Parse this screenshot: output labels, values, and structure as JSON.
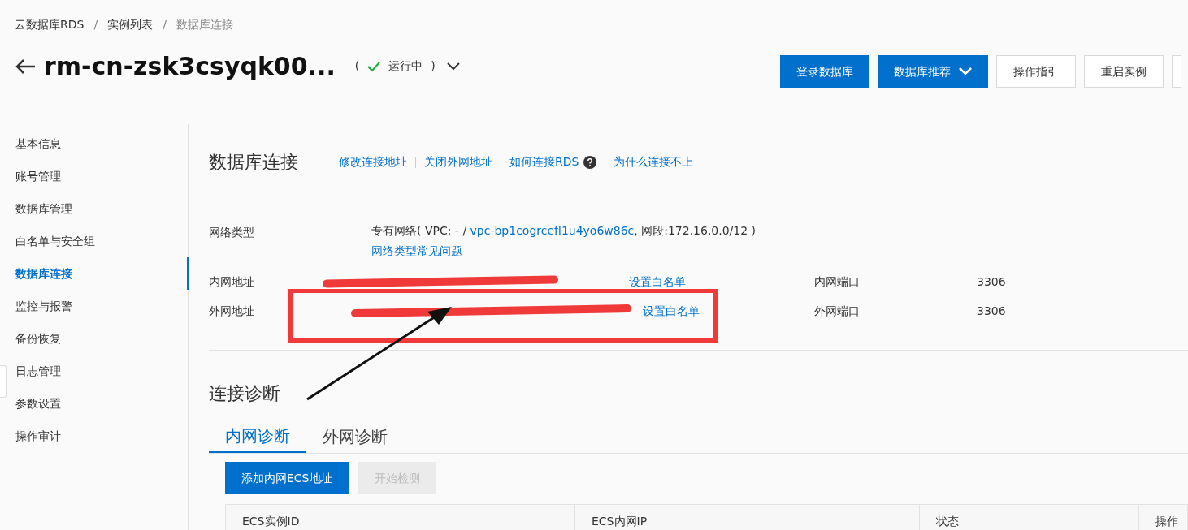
{
  "breadcrumb": [
    "云数据库RDS",
    "实例列表",
    "数据库连接"
  ],
  "breadcrumb_separator": "/",
  "instance": {
    "title": "rm-cn-zsk3csyqk00...",
    "open": "(",
    "status": "运行中",
    "close": ")",
    "running": true
  },
  "header_buttons": [
    {
      "label": "登录数据库",
      "primary": true,
      "dropdown": false
    },
    {
      "label": "数据库推荐",
      "primary": true,
      "dropdown": true
    },
    {
      "label": "操作指引",
      "primary": false,
      "dropdown": false
    },
    {
      "label": "重启实例",
      "primary": false,
      "dropdown": false
    }
  ],
  "sidebar": {
    "items": [
      {
        "label": "基本信息",
        "selected": false
      },
      {
        "label": "账号管理",
        "selected": false
      },
      {
        "label": "数据库管理",
        "selected": false
      },
      {
        "label": "白名单与安全组",
        "selected": false
      },
      {
        "label": "数据库连接",
        "selected": true
      },
      {
        "label": "监控与报警",
        "selected": false
      },
      {
        "label": "备份恢复",
        "selected": false
      },
      {
        "label": "日志管理",
        "selected": false
      },
      {
        "label": "参数设置",
        "selected": false
      },
      {
        "label": "操作审计",
        "selected": false
      }
    ]
  },
  "connection": {
    "title": "数据库连接",
    "links": [
      {
        "label": "修改连接地址",
        "help": false
      },
      {
        "label": "关闭外网地址",
        "help": false
      },
      {
        "label": "如何连接RDS",
        "help": true
      },
      {
        "label": "为什么连接不上",
        "help": false
      }
    ],
    "network_type": {
      "label": "网络类型",
      "prefix": "专有网络( VPC: - / ",
      "vpc": "vpc-bp1cogrcefl1u4yo6w86c",
      "middle": ", 网段:172.16.0.0/12 ) ",
      "faq": "网络类型常见问题"
    },
    "addresses": [
      {
        "label": "内网地址",
        "whitelist": "设置白名单",
        "port_label": "内网端口",
        "port": "3306"
      },
      {
        "label": "外网地址",
        "whitelist": "设置白名单",
        "port_label": "外网端口",
        "port": "3306"
      }
    ]
  },
  "diagnosis": {
    "title": "连接诊断",
    "tabs": [
      {
        "label": "内网诊断",
        "selected": true
      },
      {
        "label": "外网诊断",
        "selected": false
      }
    ],
    "buttons": [
      {
        "label": "添加内网ECS地址",
        "disabled": false
      },
      {
        "label": "开始检测",
        "disabled": true
      }
    ],
    "table": {
      "columns": [
        "ECS实例ID",
        "ECS内网IP",
        "状态",
        "操作"
      ]
    }
  }
}
